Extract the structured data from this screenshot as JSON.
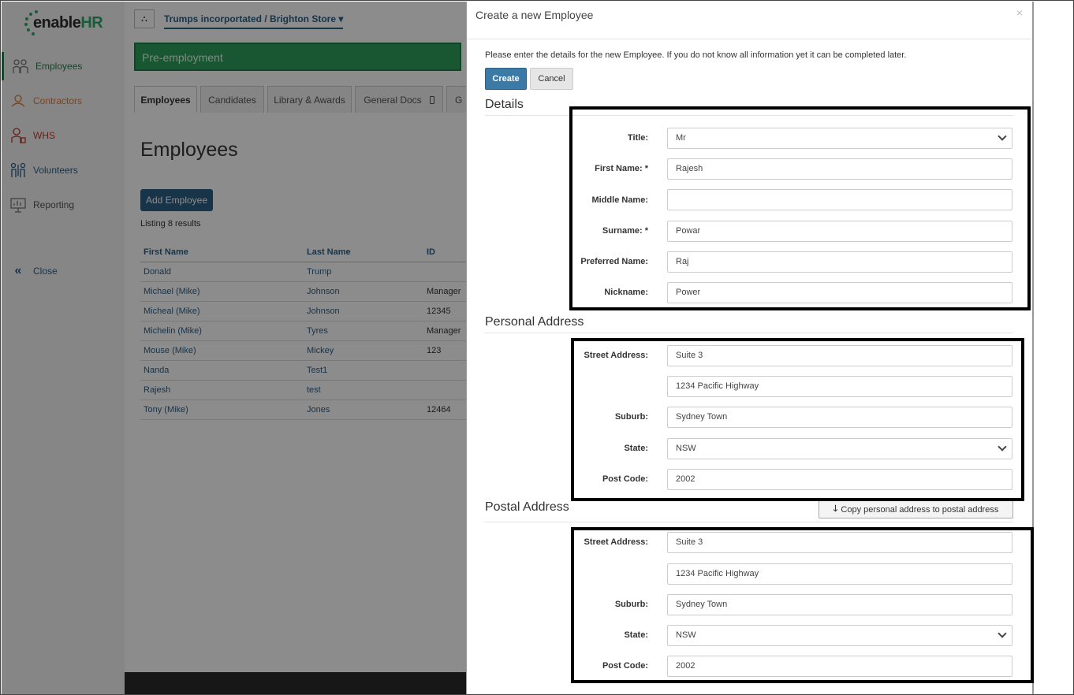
{
  "logo": {
    "text_main": "enable",
    "text_accent": "HR"
  },
  "sidebar": {
    "items": [
      {
        "label": "Employees",
        "icon": "people-icon",
        "color": "#2e7d4f"
      },
      {
        "label": "Contractors",
        "icon": "contractor-icon",
        "color": "#e07b39"
      },
      {
        "label": "WHS",
        "icon": "safety-icon",
        "color": "#c0392b"
      },
      {
        "label": "Volunteers",
        "icon": "volunteers-icon",
        "color": "#2c5f86"
      },
      {
        "label": "Reporting",
        "icon": "report-icon",
        "color": "#555555"
      }
    ],
    "close_label": "Close"
  },
  "main": {
    "org_name": "Trumps incorportated / Brighton Store",
    "banner": "Pre-employment",
    "tabs": [
      "Employees",
      "Candidates",
      "Library & Awards",
      "General Docs",
      "G"
    ],
    "page_title": "Employees",
    "add_button": "Add Employee",
    "listing": "Listing 8 results",
    "table": {
      "headers": [
        "First Name",
        "Last Name",
        "ID"
      ],
      "rows": [
        [
          "Donald",
          "Trump",
          ""
        ],
        [
          "Michael (Mike)",
          "Johnson",
          "Manager"
        ],
        [
          "Micheal (Mike)",
          "Johnson",
          "12345"
        ],
        [
          "Michelin (Mike)",
          "Tyres",
          "Manager"
        ],
        [
          "Mouse (Mike)",
          "Mickey",
          "123"
        ],
        [
          "Nanda",
          "Test1",
          ""
        ],
        [
          "Rajesh",
          "test",
          ""
        ],
        [
          "Tony (Mike)",
          "Jones",
          "12464"
        ]
      ]
    }
  },
  "modal": {
    "title": "Create a new Employee",
    "close": "×",
    "intro": "Please enter the details for the new Employee. If you do not know all information yet it can be completed later.",
    "create_label": "Create",
    "cancel_label": "Cancel",
    "details": {
      "title": "Details",
      "title_label": "Title:",
      "title_value": "Mr",
      "first_name_label": "First Name: *",
      "first_name": "Rajesh",
      "middle_name_label": "Middle Name:",
      "middle_name": "",
      "surname_label": "Surname: *",
      "surname": "Powar",
      "preferred_label": "Preferred Name:",
      "preferred": "Raj",
      "nickname_label": "Nickname:",
      "nickname": "Power"
    },
    "personal_address": {
      "title": "Personal Address",
      "street_label": "Street Address:",
      "street1": "Suite 3",
      "street2": "1234 Pacific Highway",
      "suburb_label": "Suburb:",
      "suburb": "Sydney Town",
      "state_label": "State:",
      "state": "NSW",
      "postcode_label": "Post Code:",
      "postcode": "2002"
    },
    "postal_address": {
      "title": "Postal Address",
      "copy_button": "Copy personal address to postal address",
      "street_label": "Street Address:",
      "street1": "Suite 3",
      "street2": "1234 Pacific Highway",
      "suburb_label": "Suburb:",
      "suburb": "Sydney Town",
      "state_label": "State:",
      "state": "NSW",
      "postcode_label": "Post Code:",
      "postcode": "2002"
    }
  }
}
